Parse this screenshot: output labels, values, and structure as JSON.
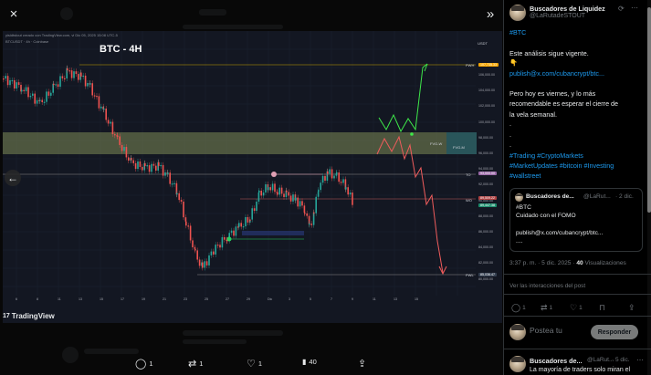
{
  "viewer": {
    "close_icon": "×",
    "expand_icon": "»",
    "prev_icon": "←"
  },
  "chart": {
    "header_line1": "yisidtstout creado con TradingView.com, vi Dic 05, 2025 15:08 UTC-5",
    "header_line2": "BTCUSDT · 4h · Coinbase",
    "currency": "USDT",
    "title": "BTC - 4H",
    "fvg_label_1": "FVG-W",
    "fvg_label_2": "FVG-M",
    "left_labels": [
      "PWH",
      "TO",
      "WO",
      "PWL"
    ],
    "price_ticks": [
      "106,000.00",
      "104,000.00",
      "102,000.00",
      "100,000.00",
      "98,000.00",
      "96,000.00",
      "94,000.00",
      "92,000.00",
      "90,000.00",
      "88,000.00",
      "86,000.00",
      "84,000.00",
      "82,000.00",
      "80,000.00"
    ],
    "badges": [
      {
        "text": "107,735.33",
        "color": "#f7a600"
      },
      {
        "text": "93,000.00",
        "color": "#9b6aa8"
      },
      {
        "text": "89,509.22",
        "color": "#b04242"
      },
      {
        "text": "89,447.38",
        "color": "#1e8f6e"
      },
      {
        "text": "85,036.47",
        "color": "#364152"
      }
    ],
    "date_ticks": [
      "6",
      "8",
      "11",
      "13",
      "15",
      "17",
      "19",
      "21",
      "23",
      "25",
      "27",
      "29",
      "Dic",
      "3",
      "5",
      "7",
      "9",
      "11",
      "13",
      "15"
    ],
    "brand": "TradingView",
    "brand_mark": "17"
  },
  "viewer_actions": [
    {
      "icon": "reply-icon",
      "glyph": "◯",
      "count": "1"
    },
    {
      "icon": "repost-icon",
      "glyph": "⇄",
      "count": "1"
    },
    {
      "icon": "like-icon",
      "glyph": "♡",
      "count": "1"
    },
    {
      "icon": "views-icon",
      "glyph": "▮",
      "count": "40"
    },
    {
      "icon": "share-icon",
      "glyph": "⇪",
      "count": ""
    }
  ],
  "tweet": {
    "author_name": "Buscadores de Liquidez",
    "author_handle": "@LaRutadeSTOUT",
    "hashtag_btc": "#BTC",
    "line1": "Este análisis sigue vigente.",
    "emoji": "👇",
    "link": "publish@x.com/cubancrypt/btc...",
    "para1": "Pero hoy es viernes, y lo más",
    "para2": "recomendable es esperar el cierre de",
    "para3": "la vela semanal.",
    "dot": ".",
    "tags1": "#Trading #CryptoMarkets",
    "tags2": "#MarketUpdates #bitcoin #Investing",
    "tags3": "#wallstreet",
    "meta_time": "3:37 p. m. · 5 dic. 2025 · ",
    "meta_views_count": "40",
    "meta_views_label": " Visualizaciones",
    "interactions_link": "Ver las interacciones del post",
    "counts": {
      "reply": "1",
      "repost": "1",
      "like": "1"
    }
  },
  "quoted": {
    "name": "Buscadores de...",
    "handle": "@LaRut...",
    "date": "· 2 dic.",
    "l1": "#BTC",
    "l2": "Cuidado con el FOMO",
    "l3": "publish@x.com/cubancrypt/btc...",
    "l4": "...."
  },
  "reply": {
    "placeholder": "Postea tu",
    "button": "Responder"
  },
  "next_tweet": {
    "name": "Buscadores de...",
    "handle": "@LaRut...",
    "date": "· 5 dic.",
    "text": "La mayoría de traders solo miran el"
  }
}
